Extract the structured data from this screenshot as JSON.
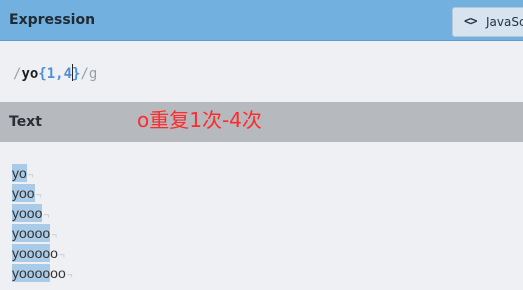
{
  "expression": {
    "title": "Expression",
    "flavor_icon": "<>",
    "flavor_label": "JavaScript",
    "open_slash": "/",
    "literal": "yo",
    "quantifier_before_caret": "{1,4",
    "quantifier_after_caret": "}",
    "close_slash": "/",
    "flags": "g"
  },
  "text_panel": {
    "title": "Text",
    "annotation": "o重复1次-4次",
    "lines": [
      {
        "match": "yo",
        "rest": ""
      },
      {
        "match": "yoo",
        "rest": ""
      },
      {
        "match": "yooo",
        "rest": ""
      },
      {
        "match": "yoooo",
        "rest": ""
      },
      {
        "match": "yoooo",
        "rest": "o"
      },
      {
        "match": "yoooo",
        "rest": "oo"
      }
    ],
    "end_of_line_marker": "¬"
  },
  "colors": {
    "expression_header": "#72b1df",
    "text_header": "#b6babe",
    "match_highlight": "#a9cbe8",
    "annotation": "#ff2a2a",
    "quantifier": "#4f8fd6"
  }
}
